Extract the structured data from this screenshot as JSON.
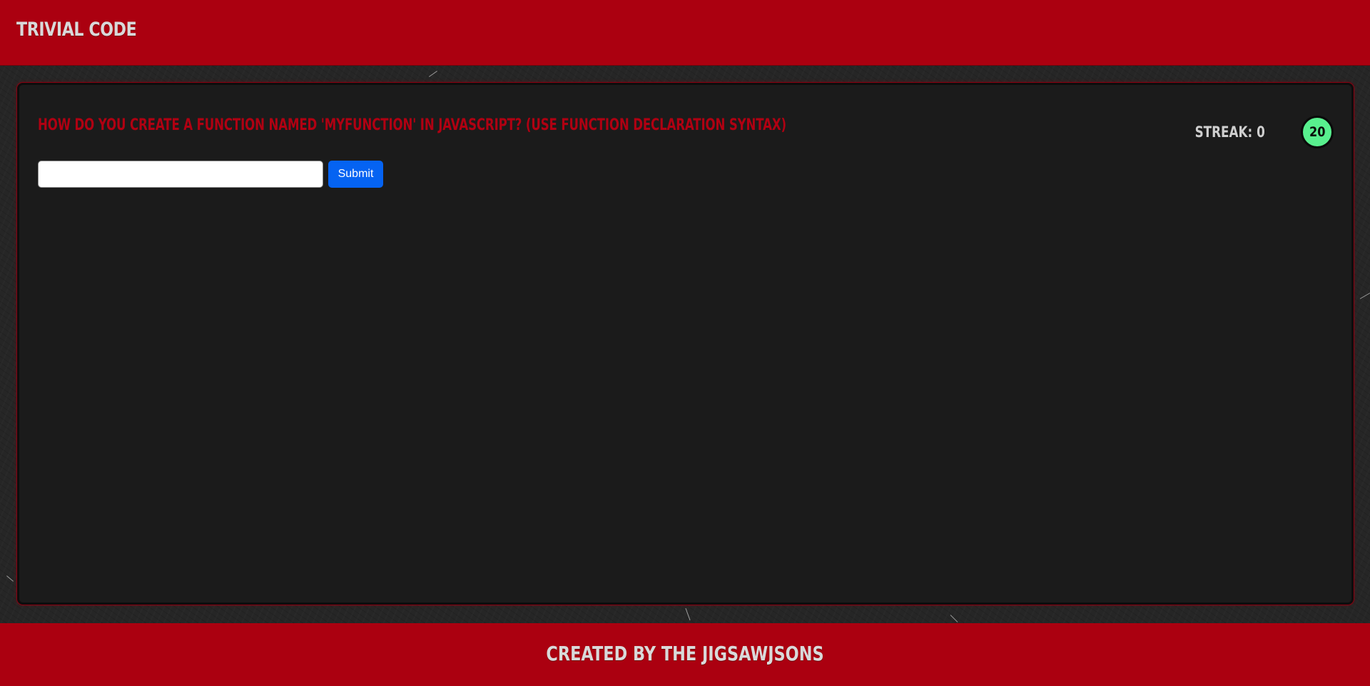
{
  "header": {
    "title": "Trivial Code"
  },
  "quiz": {
    "question": "How do you create a function named 'myFunction' in JavaScript? (Use function declaration syntax)",
    "streak_label": "Streak: 0",
    "timer_value": "20",
    "answer": {
      "value": "",
      "placeholder": ""
    },
    "submit_label": "Submit"
  },
  "footer": {
    "credit": "Created by the JigsawJsons"
  },
  "colors": {
    "brand_red": "#ab0010",
    "question_red": "#b00012",
    "timer_green": "#58f08e",
    "submit_blue": "#0563f2",
    "card_bg": "#1b1b1b"
  }
}
